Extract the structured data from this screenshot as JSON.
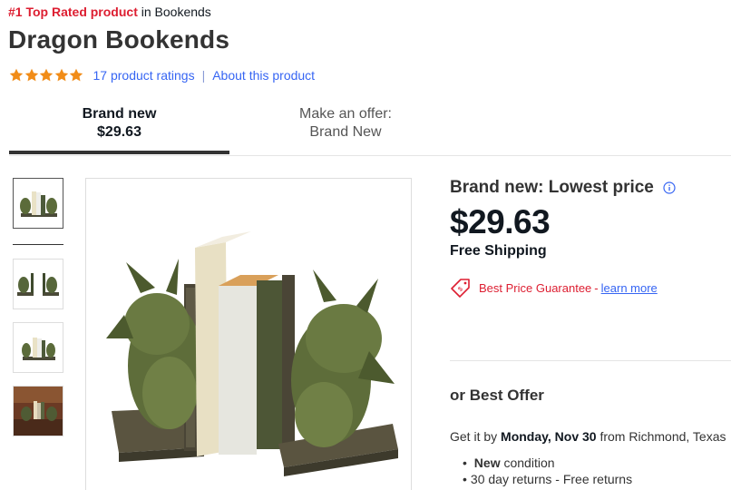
{
  "top_rated": {
    "badge": "#1 Top Rated product",
    "suffix": "in Bookends"
  },
  "product": {
    "title": "Dragon Bookends"
  },
  "ratings": {
    "stars": 5,
    "count_label": "17 product ratings",
    "about_label": "About this product",
    "star_color": "#f18c18"
  },
  "tabs": [
    {
      "line1": "Brand new",
      "line2": "$29.63",
      "selected": true
    },
    {
      "line1": "Make an offer:",
      "line2": "Brand New",
      "selected": false
    }
  ],
  "gallery": {
    "thumbnails": [
      "dragon-bookends-thumb",
      "dragon-bookends-apart-thumb",
      "dragon-bookends-small-thumb",
      "dragon-bookends-room-thumb"
    ],
    "main_image": "dragon-bookends-photo"
  },
  "pricing": {
    "heading": "Brand new: Lowest price",
    "info_icon": "info-icon",
    "price": "$29.63",
    "shipping": "Free Shipping",
    "guarantee_label": "Best Price Guarantee",
    "guarantee_dash": "-",
    "learn_more": "learn more"
  },
  "offer": {
    "label": "or Best Offer",
    "delivery_prefix": "Get it by",
    "delivery_date": "Monday, Nov 30",
    "delivery_suffix": "from Richmond, Texas",
    "condition_bold": "New",
    "condition_rest": "condition",
    "returns": "30 day returns - Free returns"
  },
  "colors": {
    "accent_red": "#dd1e31",
    "link_blue": "#3665f3",
    "text_dark": "#111820",
    "tab_underline": "#333333"
  }
}
